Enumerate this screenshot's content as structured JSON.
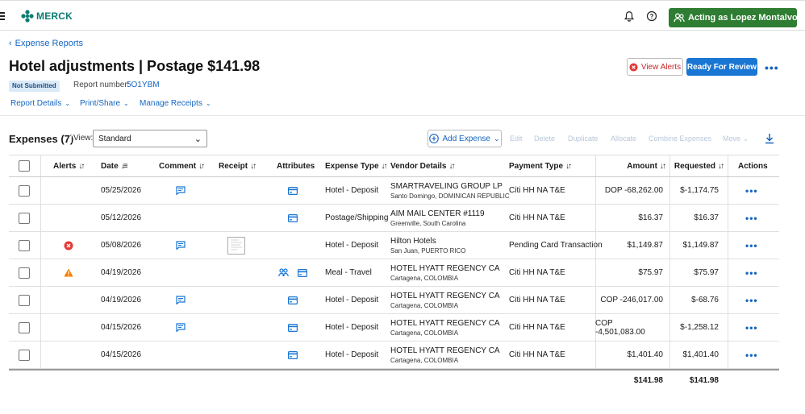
{
  "app": {
    "logo_text": "MERCK"
  },
  "topbar": {
    "acting_as": "Acting as Lopez Montalvo, Ro...",
    "notifications_icon": "bell-icon",
    "help_icon": "help-circle-icon"
  },
  "header": {
    "back_link": "Expense Reports",
    "title": "Hotel adjustments | Postage $141.98",
    "status": "Not Submitted",
    "report_number_label": "Report number:",
    "report_number": "5O1YBM",
    "view_alerts": "View Alerts",
    "ready_for_review": "Ready For Review",
    "menus": [
      "Report Details",
      "Print/Share",
      "Manage Receipts"
    ]
  },
  "toolbar": {
    "expenses_title": "Expenses (7)",
    "view_label": "View:",
    "view_value": "Standard",
    "add_expense": "Add Expense",
    "actions": [
      "Edit",
      "Delete",
      "Duplicate",
      "Allocate",
      "Combine Expenses",
      "Move"
    ]
  },
  "table": {
    "columns": {
      "alerts": "Alerts",
      "date": "Date",
      "comment": "Comment",
      "receipt": "Receipt",
      "attributes": "Attributes",
      "expense_type": "Expense Type",
      "vendor": "Vendor Details",
      "payment": "Payment Type",
      "amount": "Amount",
      "requested": "Requested",
      "actions": "Actions"
    },
    "rows": [
      {
        "alert": "",
        "date": "05/25/2026",
        "comment": true,
        "receipt": false,
        "attrs": [
          "card"
        ],
        "type": "Hotel - Deposit",
        "vendor": "SMARTRAVELING GROUP LP",
        "location": "Santo Domingo, DOMINICAN REPUBLIC",
        "payment": "Citi HH NA T&E",
        "amount": "DOP -68,262.00",
        "requested": "$-1,174.75"
      },
      {
        "alert": "",
        "date": "05/12/2026",
        "comment": false,
        "receipt": false,
        "attrs": [
          "card"
        ],
        "type": "Postage/Shipping",
        "vendor": "AIM MAIL CENTER #1119",
        "location": "Greenville, South Carolina",
        "payment": "Citi HH NA T&E",
        "amount": "$16.37",
        "requested": "$16.37"
      },
      {
        "alert": "error",
        "date": "05/08/2026",
        "comment": true,
        "receipt": true,
        "attrs": [],
        "type": "Hotel - Deposit",
        "vendor": "Hilton Hotels",
        "location": "San Juan, PUERTO RICO",
        "payment": "Pending Card Transaction",
        "amount": "$1,149.87",
        "requested": "$1,149.87"
      },
      {
        "alert": "warning",
        "date": "04/19/2026",
        "comment": false,
        "receipt": false,
        "attrs": [
          "attendees",
          "card"
        ],
        "type": "Meal - Travel",
        "vendor": "HOTEL HYATT REGENCY CA",
        "location": "Cartagena, COLOMBIA",
        "payment": "Citi HH NA T&E",
        "amount": "$75.97",
        "requested": "$75.97"
      },
      {
        "alert": "",
        "date": "04/19/2026",
        "comment": true,
        "receipt": false,
        "attrs": [
          "card"
        ],
        "type": "Hotel - Deposit",
        "vendor": "HOTEL HYATT REGENCY CA",
        "location": "Cartagena, COLOMBIA",
        "payment": "Citi HH NA T&E",
        "amount": "COP -246,017.00",
        "requested": "$-68.76"
      },
      {
        "alert": "",
        "date": "04/15/2026",
        "comment": true,
        "receipt": false,
        "attrs": [
          "card"
        ],
        "type": "Hotel - Deposit",
        "vendor": "HOTEL HYATT REGENCY CA",
        "location": "Cartagena, COLOMBIA",
        "payment": "Citi HH NA T&E",
        "amount": "COP -4,501,083.00",
        "requested": "$-1,258.12"
      },
      {
        "alert": "",
        "date": "04/15/2026",
        "comment": false,
        "receipt": false,
        "attrs": [
          "card"
        ],
        "type": "Hotel - Deposit",
        "vendor": "HOTEL HYATT REGENCY CA",
        "location": "Cartagena, COLOMBIA",
        "payment": "Citi HH NA T&E",
        "amount": "$1,401.40",
        "requested": "$1,401.40"
      }
    ],
    "totals": {
      "amount": "$141.98",
      "requested": "$141.98"
    }
  },
  "colors": {
    "brand": "#0c7c73",
    "primary": "#1976d2",
    "link": "#1565c0",
    "acting": "#2e7d32",
    "error": "#e53935",
    "warning": "#f57c00"
  }
}
